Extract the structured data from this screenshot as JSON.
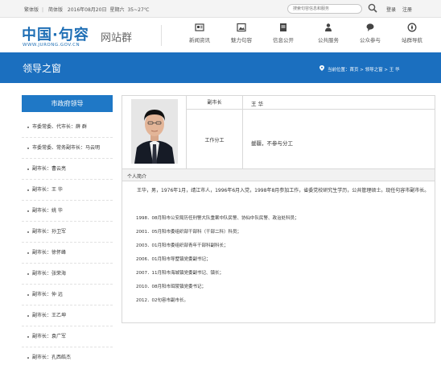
{
  "topbar": {
    "edition_simplified": "繁体版",
    "edition_separator": "|",
    "edition_traditional": "简体版",
    "date": "2016年08月20日",
    "weekday": "星期六",
    "weather": "35~27℃",
    "search_placeholder": "搜索句容信息和服务",
    "login": "登录",
    "register": "注册"
  },
  "header": {
    "logo_text": "中国·句容",
    "logo_url": "WWW.JURONG.GOV.CN",
    "logo_subtitle": "网站群",
    "nav": [
      {
        "label": "新闻资讯",
        "icon": "news-icon"
      },
      {
        "label": "魅力句容",
        "icon": "picture-icon"
      },
      {
        "label": "信息公开",
        "icon": "document-icon"
      },
      {
        "label": "公共服务",
        "icon": "service-icon"
      },
      {
        "label": "公众参与",
        "icon": "chat-icon"
      },
      {
        "label": "站群导航",
        "icon": "compass-icon"
      }
    ]
  },
  "banner": {
    "title": "领导之窗",
    "location_label": "当前位置：",
    "location_path": "首页 > 领导之窗 > 王  华"
  },
  "sidebar": {
    "heading": "市政府领导",
    "items": [
      "市委常委、代市长：薛  群",
      "市委常委、常务副市长：马云明",
      "副市长：曹云亮",
      "副市长：王  华",
      "副市长：姚  华",
      "副市长：孙卫军",
      "副市长：徐怀峰",
      "副市长：张荣海",
      "副市长：仲  远",
      "副市长：王乙坤",
      "副市长：袁广军",
      "副市长：孔西皓杰"
    ]
  },
  "profile": {
    "title_label": "副市长",
    "name": "王  华",
    "duty_label": "工作分工",
    "duty_value": "援疆，不参与分工",
    "intro_label": "个人简介",
    "bio": "王华，男，1976年1月，靖江市人，1996年6月入党，1998年8月参加工作，省委党校研究生学历，公共管理硕士。现任句容市副市长。",
    "experience": [
      "1998．08月阳市公安局历任刑警大队重案中队民警、协仙中队民警、政治处科员；",
      "2001．05月阳市委组织部干部科（干部二科）科员；",
      "2003．01月阳市委组织部青年干部科副科长；",
      "2006．01月阳市导墅镇党委副书记；",
      "2007．11月阳市海城镇党委副书记、镇长；",
      "2010．08月阳市珥陵镇党委书记；",
      "2012．02句容市副市长。"
    ]
  },
  "colors": {
    "brand_blue": "#1b6fbf",
    "sidebar_head": "#1f78c6"
  }
}
